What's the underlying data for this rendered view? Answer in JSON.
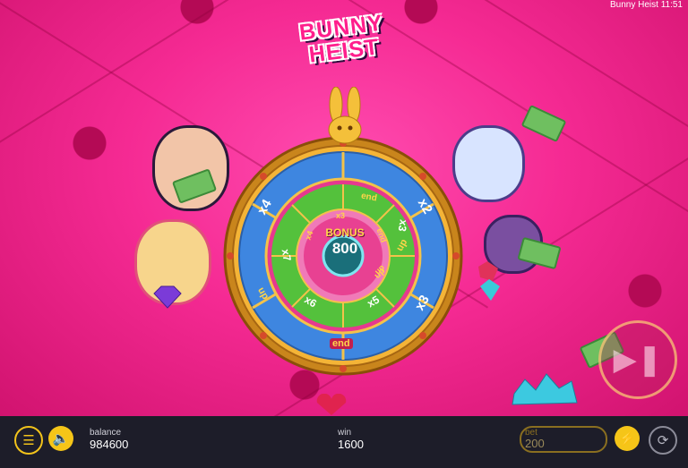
{
  "status_bar": {
    "text": "Bunny Heist 11:51"
  },
  "game": {
    "logo_line1": "BUNNY",
    "logo_line2": "HEIST"
  },
  "wheel": {
    "center_label": "BONUS",
    "center_value": "800",
    "outer_labels": [
      "x2",
      "up",
      "x3",
      "end",
      "up",
      "x4"
    ],
    "middle_labels": [
      "end",
      "up",
      "x5",
      "x6",
      "x7",
      "x3"
    ],
    "inner_labels": [
      "x3",
      "end",
      "up",
      "x4"
    ]
  },
  "bottom_bar": {
    "balance_label": "balance",
    "balance_value": "984600",
    "win_label": "win",
    "win_value": "1600",
    "bet_label": "bet",
    "bet_value": "200"
  },
  "colors": {
    "accent": "#f5c518",
    "bar_bg": "#1d1d29",
    "background": "#f52a93"
  },
  "icons": {
    "menu": "menu-icon",
    "sound": "speaker-icon",
    "turbo": "lightning-icon",
    "autoplay": "autoplay-icon",
    "play": "play-skip-icon"
  }
}
